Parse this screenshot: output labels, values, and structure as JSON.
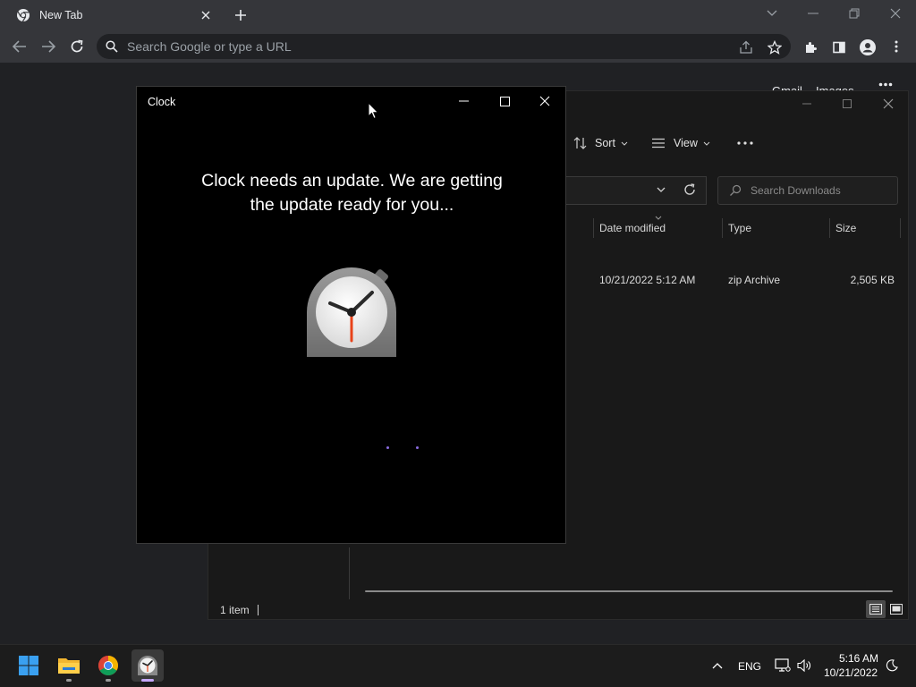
{
  "chrome": {
    "tab_title": "New Tab",
    "omnibox_placeholder": "Search Google or type a URL",
    "links": [
      "Gmail",
      "Images"
    ]
  },
  "explorer": {
    "sort_label": "Sort",
    "view_label": "View",
    "search_placeholder": "Search Downloads",
    "columns": [
      "Date modified",
      "Type",
      "Size"
    ],
    "row": {
      "date_modified": "10/21/2022 5:12 AM",
      "type": "zip Archive",
      "size": "2,505 KB"
    },
    "status": "1 item"
  },
  "clock_window": {
    "title": "Clock",
    "message": "Clock needs an update. We are getting the update ready for you..."
  },
  "taskbar": {
    "language": "ENG",
    "time": "5:16 AM",
    "date": "10/21/2022"
  },
  "colors": {
    "accent_red": "#e8431a",
    "loader_purple": "#8a6be0"
  }
}
